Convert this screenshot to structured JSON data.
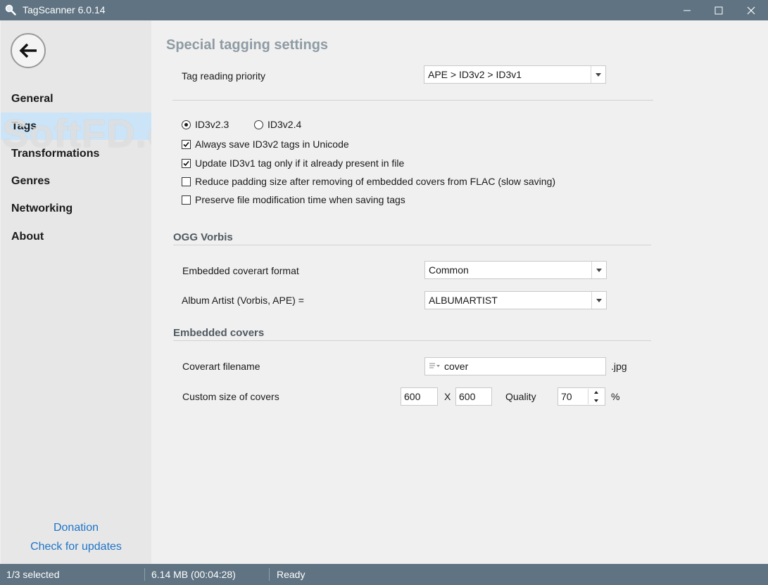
{
  "window": {
    "title": "TagScanner 6.0.14"
  },
  "sidebar": {
    "items": [
      {
        "label": "General"
      },
      {
        "label": "Tags"
      },
      {
        "label": "Transformations"
      },
      {
        "label": "Genres"
      },
      {
        "label": "Networking"
      },
      {
        "label": "About"
      }
    ],
    "active": "Tags",
    "watermark": "SoftFD.com",
    "donation": "Donation",
    "check_updates": "Check for updates"
  },
  "main": {
    "title": "Special tagging settings",
    "tag_reading_priority": {
      "label": "Tag reading priority",
      "value": "APE > ID3v2 > ID3v1"
    },
    "id3_version": {
      "options": [
        "ID3v2.3",
        "ID3v2.4"
      ],
      "selected": "ID3v2.3"
    },
    "options": [
      {
        "label": "Always save ID3v2 tags in Unicode",
        "checked": true
      },
      {
        "label": "Update ID3v1 tag only if it already present in file",
        "checked": true
      },
      {
        "label": "Reduce padding size after removing of embedded covers from FLAC (slow saving)",
        "checked": false
      },
      {
        "label": "Preserve file modification time when saving tags",
        "checked": false
      }
    ],
    "ogg": {
      "section": "OGG Vorbis",
      "coverart_label": "Embedded coverart format",
      "coverart_value": "Common",
      "album_artist_label": "Album Artist (Vorbis, APE) =",
      "album_artist_value": "ALBUMARTIST"
    },
    "covers": {
      "section": "Embedded covers",
      "filename_label": "Coverart filename",
      "filename_value": "cover",
      "filename_ext": ".jpg",
      "size_label": "Custom size of covers",
      "width": "600",
      "x": "X",
      "height": "600",
      "quality_label": "Quality",
      "quality_value": "70",
      "percent": "%"
    }
  },
  "status": {
    "selected": "1/3 selected",
    "size": "6.14 MB (00:04:28)",
    "state": "Ready"
  },
  "colors": {
    "titlebar": "#5f7382",
    "active_nav": "#cce4f7",
    "link": "#1f74c8",
    "section_title": "#8e9ba4"
  }
}
